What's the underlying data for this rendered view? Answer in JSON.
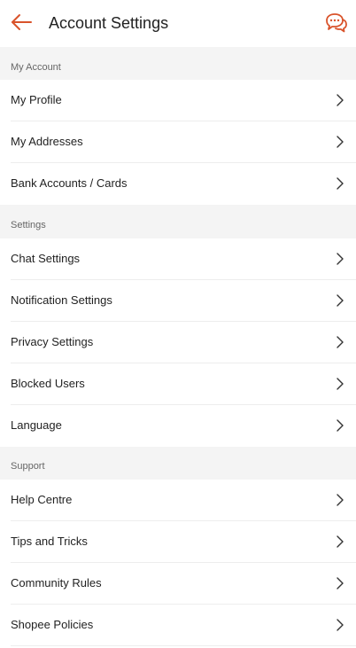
{
  "header": {
    "title": "Account Settings",
    "back_icon": "arrow-left-icon",
    "chat_icon": "chat-bubbles-icon",
    "accent_color": "#d9532b"
  },
  "sections": [
    {
      "label": "My Account",
      "items": [
        {
          "label": "My Profile"
        },
        {
          "label": "My Addresses"
        },
        {
          "label": "Bank Accounts / Cards"
        }
      ]
    },
    {
      "label": "Settings",
      "items": [
        {
          "label": "Chat Settings"
        },
        {
          "label": "Notification Settings"
        },
        {
          "label": "Privacy Settings"
        },
        {
          "label": "Blocked Users"
        },
        {
          "label": "Language"
        }
      ]
    },
    {
      "label": "Support",
      "items": [
        {
          "label": "Help Centre"
        },
        {
          "label": "Tips and Tricks"
        },
        {
          "label": "Community Rules"
        },
        {
          "label": "Shopee Policies"
        }
      ]
    }
  ]
}
